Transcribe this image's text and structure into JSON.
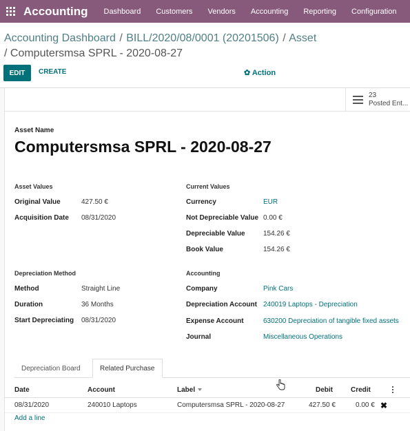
{
  "navbar": {
    "app_name": "Accounting",
    "menu": [
      "Dashboard",
      "Customers",
      "Vendors",
      "Accounting",
      "Reporting",
      "Configuration"
    ],
    "color": "#875a7b"
  },
  "breadcrumb": {
    "items": [
      "Accounting Dashboard",
      "BILL/2020/08/0001 (20201506)",
      "Asset"
    ],
    "separator": "/",
    "current": "/ Computersmsa SPRL - 2020-08-27"
  },
  "toolbar": {
    "edit_label": "EDIT",
    "create_label": "CREATE",
    "action_label": "✿ Action"
  },
  "stat_button": {
    "count": "23",
    "label": "Posted Ent..."
  },
  "asset": {
    "name_label": "Asset Name",
    "name": "Computersmsa SPRL - 2020-08-27"
  },
  "asset_values": {
    "title": "Asset Values",
    "original_value_label": "Original Value",
    "original_value": "427.50 €",
    "acquisition_date_label": "Acquisition Date",
    "acquisition_date": "08/31/2020"
  },
  "current_values": {
    "title": "Current Values",
    "currency_label": "Currency",
    "currency": "EUR",
    "not_depreciable_label": "Not Depreciable Value",
    "not_depreciable": "0.00 €",
    "depreciable_label": "Depreciable Value",
    "depreciable": "154.26 €",
    "book_value_label": "Book Value",
    "book_value": "154.26 €"
  },
  "depreciation_method": {
    "title": "Depreciation Method",
    "method_label": "Method",
    "method": "Straight Line",
    "duration_label": "Duration",
    "duration": "36  Months",
    "start_label": "Start Depreciating",
    "start": "08/31/2020"
  },
  "accounting": {
    "title": "Accounting",
    "company_label": "Company",
    "company": "Pink Cars",
    "depreciation_account_label": "Depreciation Account",
    "depreciation_account": "240019 Laptops - Depreciation",
    "expense_account_label": "Expense Account",
    "expense_account": "630200 Depreciation of tangible fixed assets",
    "journal_label": "Journal",
    "journal": "Miscellaneous Operations"
  },
  "tabs": [
    "Depreciation Board",
    "Related Purchase"
  ],
  "table": {
    "columns": [
      "Date",
      "Account",
      "Label",
      "Debit",
      "Credit"
    ],
    "rows": [
      {
        "date": "08/31/2020",
        "account": "240010 Laptops",
        "label": "Computersmsa SPRL - 2020-08-27",
        "debit": "427.50 €",
        "credit": "0.00 €"
      }
    ],
    "add_line": "Add a line"
  }
}
